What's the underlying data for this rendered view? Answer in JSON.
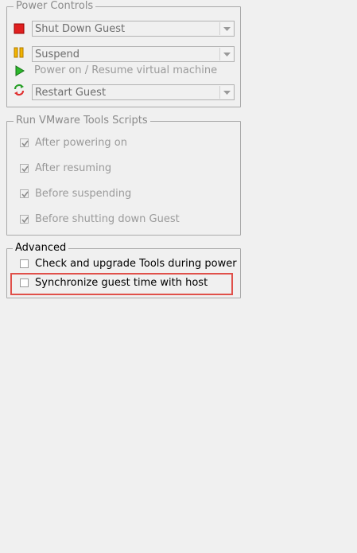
{
  "power_controls": {
    "legend": "Power Controls",
    "stop": {
      "icon": "stop-square-icon",
      "color": "#e02020",
      "selected": "Shut Down Guest"
    },
    "pause": {
      "icon": "pause-bars-icon",
      "color": "#e8a000",
      "selected": "Suspend"
    },
    "power_on": {
      "icon": "play-triangle-icon",
      "color": "#22b022",
      "label": "Power on / Resume virtual machine"
    },
    "reset": {
      "icon": "restart-arrows-icon",
      "selected": "Restart Guest"
    }
  },
  "scripts": {
    "legend": "Run VMware Tools Scripts",
    "items": [
      {
        "label": "After powering on",
        "checked": true
      },
      {
        "label": "After resuming",
        "checked": true
      },
      {
        "label": "Before suspending",
        "checked": true
      },
      {
        "label": "Before shutting down Guest",
        "checked": true
      }
    ]
  },
  "advanced": {
    "legend": "Advanced",
    "items": [
      {
        "label": "Check and upgrade Tools during power",
        "checked": false
      },
      {
        "label": "Synchronize guest time with host",
        "checked": false
      }
    ],
    "highlight_color": "#e0504a"
  }
}
